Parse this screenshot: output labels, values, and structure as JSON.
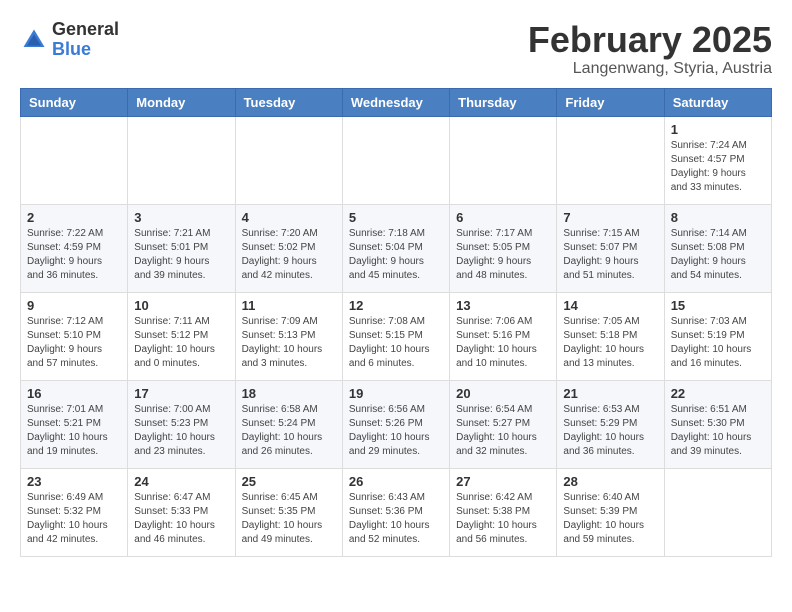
{
  "header": {
    "logo_general": "General",
    "logo_blue": "Blue",
    "month_year": "February 2025",
    "location": "Langenwang, Styria, Austria"
  },
  "days_of_week": [
    "Sunday",
    "Monday",
    "Tuesday",
    "Wednesday",
    "Thursday",
    "Friday",
    "Saturday"
  ],
  "weeks": [
    [
      {
        "day": "",
        "info": ""
      },
      {
        "day": "",
        "info": ""
      },
      {
        "day": "",
        "info": ""
      },
      {
        "day": "",
        "info": ""
      },
      {
        "day": "",
        "info": ""
      },
      {
        "day": "",
        "info": ""
      },
      {
        "day": "1",
        "info": "Sunrise: 7:24 AM\nSunset: 4:57 PM\nDaylight: 9 hours and 33 minutes."
      }
    ],
    [
      {
        "day": "2",
        "info": "Sunrise: 7:22 AM\nSunset: 4:59 PM\nDaylight: 9 hours and 36 minutes."
      },
      {
        "day": "3",
        "info": "Sunrise: 7:21 AM\nSunset: 5:01 PM\nDaylight: 9 hours and 39 minutes."
      },
      {
        "day": "4",
        "info": "Sunrise: 7:20 AM\nSunset: 5:02 PM\nDaylight: 9 hours and 42 minutes."
      },
      {
        "day": "5",
        "info": "Sunrise: 7:18 AM\nSunset: 5:04 PM\nDaylight: 9 hours and 45 minutes."
      },
      {
        "day": "6",
        "info": "Sunrise: 7:17 AM\nSunset: 5:05 PM\nDaylight: 9 hours and 48 minutes."
      },
      {
        "day": "7",
        "info": "Sunrise: 7:15 AM\nSunset: 5:07 PM\nDaylight: 9 hours and 51 minutes."
      },
      {
        "day": "8",
        "info": "Sunrise: 7:14 AM\nSunset: 5:08 PM\nDaylight: 9 hours and 54 minutes."
      }
    ],
    [
      {
        "day": "9",
        "info": "Sunrise: 7:12 AM\nSunset: 5:10 PM\nDaylight: 9 hours and 57 minutes."
      },
      {
        "day": "10",
        "info": "Sunrise: 7:11 AM\nSunset: 5:12 PM\nDaylight: 10 hours and 0 minutes."
      },
      {
        "day": "11",
        "info": "Sunrise: 7:09 AM\nSunset: 5:13 PM\nDaylight: 10 hours and 3 minutes."
      },
      {
        "day": "12",
        "info": "Sunrise: 7:08 AM\nSunset: 5:15 PM\nDaylight: 10 hours and 6 minutes."
      },
      {
        "day": "13",
        "info": "Sunrise: 7:06 AM\nSunset: 5:16 PM\nDaylight: 10 hours and 10 minutes."
      },
      {
        "day": "14",
        "info": "Sunrise: 7:05 AM\nSunset: 5:18 PM\nDaylight: 10 hours and 13 minutes."
      },
      {
        "day": "15",
        "info": "Sunrise: 7:03 AM\nSunset: 5:19 PM\nDaylight: 10 hours and 16 minutes."
      }
    ],
    [
      {
        "day": "16",
        "info": "Sunrise: 7:01 AM\nSunset: 5:21 PM\nDaylight: 10 hours and 19 minutes."
      },
      {
        "day": "17",
        "info": "Sunrise: 7:00 AM\nSunset: 5:23 PM\nDaylight: 10 hours and 23 minutes."
      },
      {
        "day": "18",
        "info": "Sunrise: 6:58 AM\nSunset: 5:24 PM\nDaylight: 10 hours and 26 minutes."
      },
      {
        "day": "19",
        "info": "Sunrise: 6:56 AM\nSunset: 5:26 PM\nDaylight: 10 hours and 29 minutes."
      },
      {
        "day": "20",
        "info": "Sunrise: 6:54 AM\nSunset: 5:27 PM\nDaylight: 10 hours and 32 minutes."
      },
      {
        "day": "21",
        "info": "Sunrise: 6:53 AM\nSunset: 5:29 PM\nDaylight: 10 hours and 36 minutes."
      },
      {
        "day": "22",
        "info": "Sunrise: 6:51 AM\nSunset: 5:30 PM\nDaylight: 10 hours and 39 minutes."
      }
    ],
    [
      {
        "day": "23",
        "info": "Sunrise: 6:49 AM\nSunset: 5:32 PM\nDaylight: 10 hours and 42 minutes."
      },
      {
        "day": "24",
        "info": "Sunrise: 6:47 AM\nSunset: 5:33 PM\nDaylight: 10 hours and 46 minutes."
      },
      {
        "day": "25",
        "info": "Sunrise: 6:45 AM\nSunset: 5:35 PM\nDaylight: 10 hours and 49 minutes."
      },
      {
        "day": "26",
        "info": "Sunrise: 6:43 AM\nSunset: 5:36 PM\nDaylight: 10 hours and 52 minutes."
      },
      {
        "day": "27",
        "info": "Sunrise: 6:42 AM\nSunset: 5:38 PM\nDaylight: 10 hours and 56 minutes."
      },
      {
        "day": "28",
        "info": "Sunrise: 6:40 AM\nSunset: 5:39 PM\nDaylight: 10 hours and 59 minutes."
      },
      {
        "day": "",
        "info": ""
      }
    ]
  ]
}
